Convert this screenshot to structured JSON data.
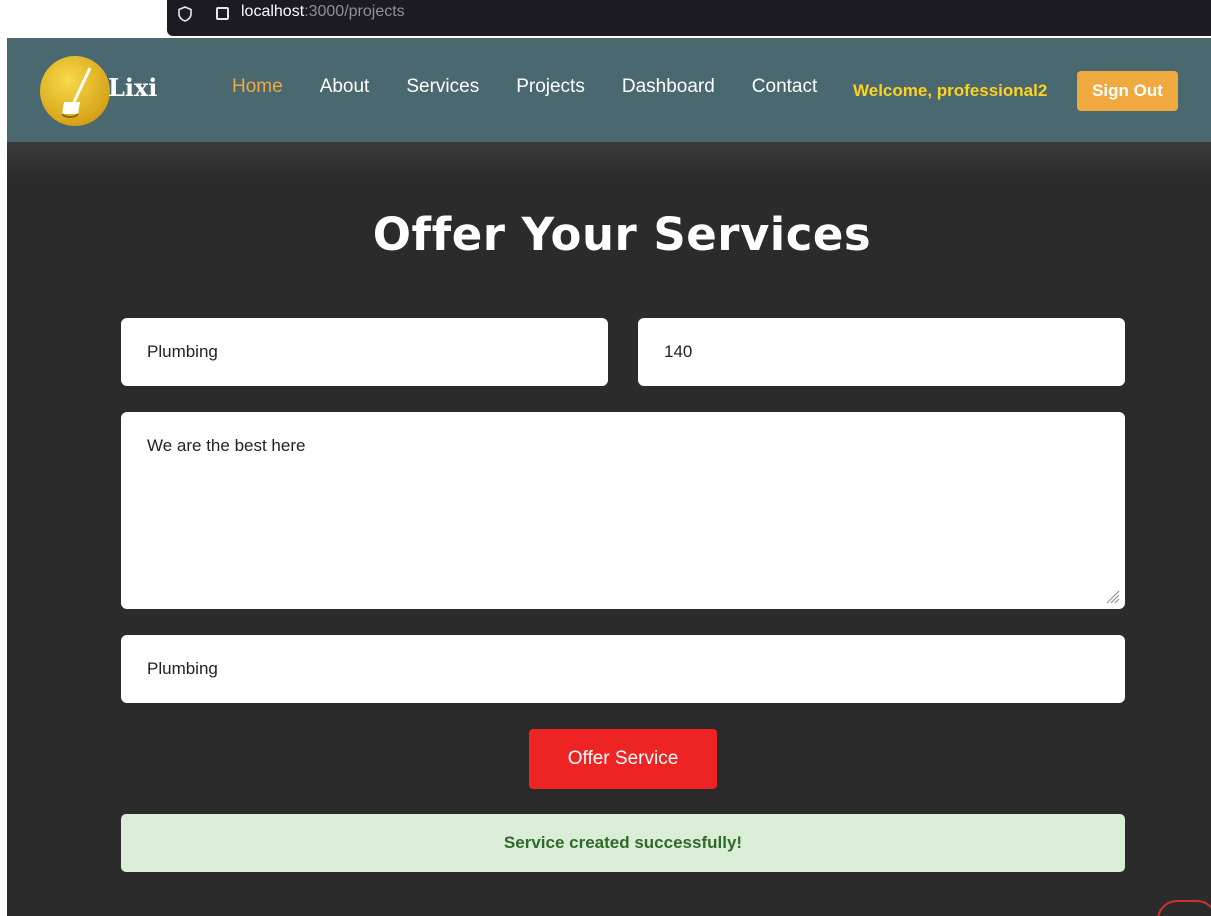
{
  "browser": {
    "url_host": "localhost",
    "url_path": ":3000/projects"
  },
  "nav": {
    "brand": "Lixi",
    "links": [
      "Home",
      "About",
      "Services",
      "Projects",
      "Dashboard",
      "Contact"
    ],
    "welcome": "Welcome, professional2",
    "sign_out": "Sign Out"
  },
  "form": {
    "title": "Offer Your Services",
    "service_name": "Plumbing",
    "price": "140",
    "description": "We are the best here",
    "category": "Plumbing",
    "submit_label": "Offer Service",
    "success_message": "Service created successfully!"
  },
  "colors": {
    "nav_bg": "#4a6870",
    "page_bg": "#2b2b2b",
    "accent_orange": "#f0a93f",
    "welcome_yellow": "#ffd21f",
    "submit_red": "#ee2424",
    "success_bg": "#daedd6",
    "success_text": "#2f6a2a"
  }
}
